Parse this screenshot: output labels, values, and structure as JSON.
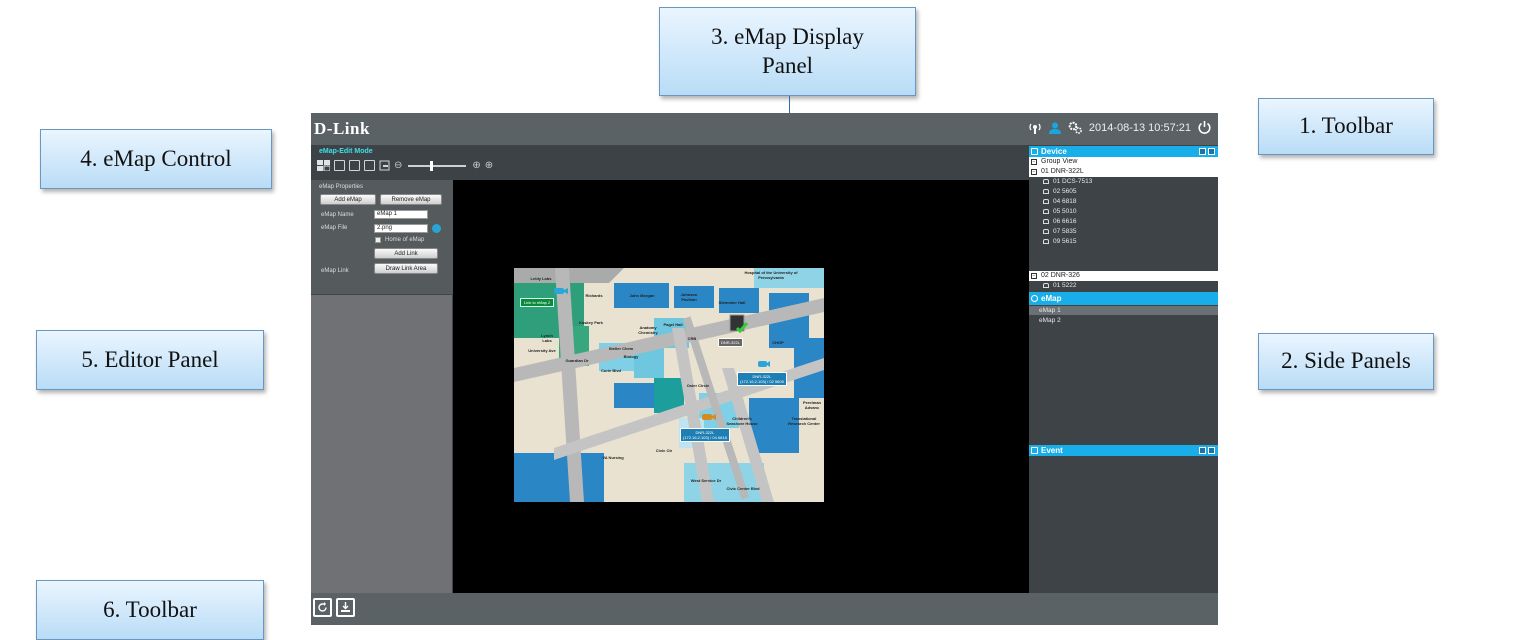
{
  "callouts": {
    "toolbar_top": "1. Toolbar",
    "side_panels": "2. Side Panels",
    "display_line1": "3. eMap Display",
    "display_line2": "Panel",
    "emap_control": "4. eMap Control",
    "editor_panel": "5. Editor Panel",
    "toolbar_bottom": "6. Toolbar"
  },
  "topbar": {
    "logo": "D-Link",
    "datetime": "2014-08-13 10:57:21"
  },
  "control": {
    "mode": "eMap-Edit Mode",
    "zoom_level": 0.4
  },
  "editor": {
    "title": "eMap Properties",
    "add_emap": "Add eMap",
    "remove_emap": "Remove eMap",
    "name_label": "eMap Name",
    "name_value": "eMap 1",
    "file_label": "eMap File",
    "file_value": "2.png",
    "home_label": "Home of eMap",
    "link_label": "eMap Link",
    "add_link": "Add Link",
    "draw_link_area": "Draw Link Area"
  },
  "map": {
    "link_tag": "Link to eMap 2",
    "device_tag_top": "DNR-322L",
    "device_tag_right": [
      "DNR-322L",
      "(172.16.2.103) / 02 5605"
    ],
    "device_tag_bottom": [
      "DNR-322L",
      "(172.16.2.103) / 04 6818"
    ],
    "place_labels": [
      "Hospital of the University of Pennsylvania",
      "Leidy Labs",
      "Richards",
      "John Morgan",
      "Johnson Pavilion",
      "Stemmler Hall",
      "Anatomy Chemistry",
      "Pagel Hall",
      "Kaskey Park",
      "Steller Chem",
      "Biology",
      "CRB",
      "CHOP",
      "Lynch Labs",
      "Curie Blvd",
      "Guardian Dr",
      "University Ave",
      "Osler Circle",
      "Civic Ctr",
      "VA Nursing",
      "Children's Seashore House",
      "Translational Research Center",
      "Perelman Advanc",
      "West Service Dr",
      "Civic Center Blvd"
    ]
  },
  "side": {
    "device_header": "Device",
    "group_view": "Group View",
    "group1": "01 DNR-322L",
    "group1_items": [
      "01 DCS-7513",
      "02 5605",
      "04 6818",
      "05 5010",
      "06 6616",
      "07 5835",
      "09 5615"
    ],
    "group2": "02 DNR-326",
    "group2_items": [
      "01 5222"
    ],
    "emap_header": "eMap",
    "emap_items": [
      "eMap 1",
      "eMap 2"
    ],
    "event_header": "Event"
  },
  "colors": {
    "accent": "#18aeea",
    "toolbar": "#5b6265",
    "mode_text": "#3fe0e8"
  }
}
